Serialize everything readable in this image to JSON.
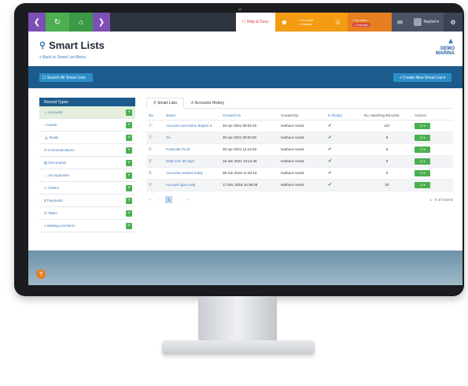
{
  "topbar": {
    "help_label": "☐ Help & Docs",
    "notice1": {
      "line1": "• You have",
      "line2": "• Overdue"
    },
    "notice2": {
      "line1": "• You have",
      "badge": "• Overdue"
    },
    "user_name": "Rachel ▾"
  },
  "header": {
    "title": "Smart Lists",
    "back_link": "< Back to Smart List Menu",
    "logo_line1": "DEMO",
    "logo_line2": "MARINA"
  },
  "actions": {
    "search_all": "☐ Search All Smart Lists",
    "create_new": "+ Create New Smart List ▾"
  },
  "sidebar": {
    "heading": "Record Types",
    "items": [
      {
        "label": "Accounts"
      },
      {
        "label": "Assets"
      },
      {
        "label": "Boats"
      },
      {
        "label": "Communications"
      },
      {
        "label": "Documents"
      },
      {
        "label": "Occupancies"
      },
      {
        "label": "Orders"
      },
      {
        "label": "Payments"
      },
      {
        "label": "Tasks"
      },
      {
        "label": "Waiting List Items"
      }
    ]
  },
  "tabs": {
    "smart_lists": "Smart Lists",
    "history": "Accounts History"
  },
  "table": {
    "headers": [
      "Na.",
      "Name",
      "Created On",
      "Created By",
      "Is Global",
      "No. Matching Records",
      "Actions"
    ],
    "rows": [
      {
        "name": "Account Last Name Begins S",
        "created_on": "30 Apr 2021 09:02:10",
        "created_by": "Harbour Assist",
        "count": "137"
      },
      {
        "name": "Gil",
        "created_on": "30 Apr 2021 09:03:30",
        "created_by": "Harbour Assist",
        "count": "0"
      },
      {
        "name": "Postcode PL33",
        "created_on": "30 Apr 2021 12:14:33",
        "created_by": "Harbour Assist",
        "count": "5"
      },
      {
        "name": "Debt over 30 days",
        "created_on": "15 Jan 2021 13:14:48",
        "created_by": "Harbour Assist",
        "count": "0"
      },
      {
        "name": "Accounts created today",
        "created_on": "08 Jun 2019 11:33:13",
        "created_by": "Harbour Assist",
        "count": "0"
      },
      {
        "name": "Account type Lead",
        "created_on": "17 Dec 2018 16:39:48",
        "created_by": "Harbour Assist",
        "count": "20"
      }
    ],
    "action_label": "☐ ▾"
  },
  "pager": {
    "current": "1",
    "info": "1 - 6 of 6 items"
  },
  "colors": {
    "accent": "#1d5b8c",
    "green": "#4caf50",
    "orange": "#f39c12"
  }
}
